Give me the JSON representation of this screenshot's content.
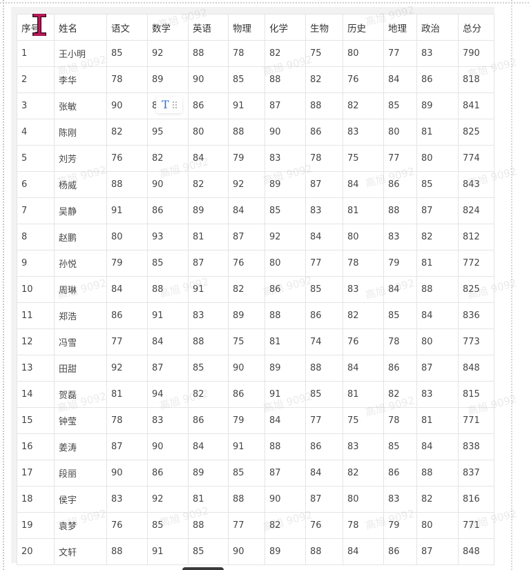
{
  "table": {
    "headers": [
      "序号",
      "姓名",
      "语文",
      "数学",
      "英语",
      "物理",
      "化学",
      "生物",
      "历史",
      "地理",
      "政治",
      "总分"
    ],
    "rows": [
      [
        "1",
        "王小明",
        "85",
        "92",
        "88",
        "78",
        "82",
        "75",
        "80",
        "77",
        "83",
        "790"
      ],
      [
        "2",
        "李华",
        "78",
        "89",
        "90",
        "85",
        "88",
        "82",
        "76",
        "84",
        "86",
        "818"
      ],
      [
        "3",
        "张敏",
        "90",
        "8",
        "86",
        "91",
        "87",
        "88",
        "82",
        "85",
        "89",
        "841"
      ],
      [
        "4",
        "陈刚",
        "82",
        "95",
        "80",
        "88",
        "90",
        "86",
        "83",
        "80",
        "81",
        "825"
      ],
      [
        "5",
        "刘芳",
        "76",
        "82",
        "84",
        "79",
        "83",
        "78",
        "75",
        "77",
        "80",
        "774"
      ],
      [
        "6",
        "杨威",
        "88",
        "90",
        "82",
        "92",
        "89",
        "87",
        "84",
        "86",
        "85",
        "843"
      ],
      [
        "7",
        "吴静",
        "91",
        "86",
        "89",
        "84",
        "85",
        "83",
        "81",
        "88",
        "87",
        "824"
      ],
      [
        "8",
        "赵鹏",
        "80",
        "93",
        "81",
        "87",
        "92",
        "84",
        "80",
        "83",
        "82",
        "812"
      ],
      [
        "9",
        "孙悦",
        "79",
        "85",
        "87",
        "76",
        "80",
        "77",
        "78",
        "79",
        "81",
        "772"
      ],
      [
        "10",
        "周琳",
        "84",
        "88",
        "91",
        "82",
        "86",
        "85",
        "83",
        "84",
        "88",
        "825"
      ],
      [
        "11",
        "郑浩",
        "86",
        "91",
        "83",
        "89",
        "88",
        "86",
        "82",
        "85",
        "84",
        "836"
      ],
      [
        "12",
        "冯雪",
        "77",
        "84",
        "88",
        "75",
        "81",
        "74",
        "76",
        "78",
        "80",
        "773"
      ],
      [
        "13",
        "田甜",
        "92",
        "87",
        "85",
        "90",
        "89",
        "88",
        "84",
        "86",
        "87",
        "848"
      ],
      [
        "14",
        "贺磊",
        "81",
        "94",
        "82",
        "86",
        "91",
        "85",
        "81",
        "82",
        "83",
        "815"
      ],
      [
        "15",
        "钟莹",
        "78",
        "83",
        "86",
        "79",
        "84",
        "77",
        "75",
        "78",
        "81",
        "771"
      ],
      [
        "16",
        "姜涛",
        "87",
        "90",
        "84",
        "91",
        "88",
        "86",
        "83",
        "85",
        "84",
        "838"
      ],
      [
        "17",
        "段丽",
        "90",
        "86",
        "89",
        "85",
        "87",
        "84",
        "82",
        "86",
        "88",
        "837"
      ],
      [
        "18",
        "侯宇",
        "83",
        "92",
        "81",
        "88",
        "90",
        "87",
        "80",
        "83",
        "82",
        "816"
      ],
      [
        "19",
        "袁梦",
        "76",
        "85",
        "88",
        "77",
        "82",
        "76",
        "78",
        "79",
        "80",
        "771"
      ],
      [
        "20",
        "文轩",
        "88",
        "91",
        "85",
        "90",
        "89",
        "88",
        "84",
        "86",
        "87",
        "848"
      ]
    ]
  },
  "watermark_text": "高旭 9092",
  "toolbar": {
    "text_style_glyph": "T",
    "icons": [
      "text-style-icon",
      "drag-handle-icon"
    ]
  },
  "cursor": {
    "icon": "text-cursor-icon",
    "color": "#c2185b"
  },
  "colors": {
    "grid_line": "#e4e4e4",
    "toolbar_accent": "#2b6fd6",
    "cursor": "#c2185b"
  }
}
